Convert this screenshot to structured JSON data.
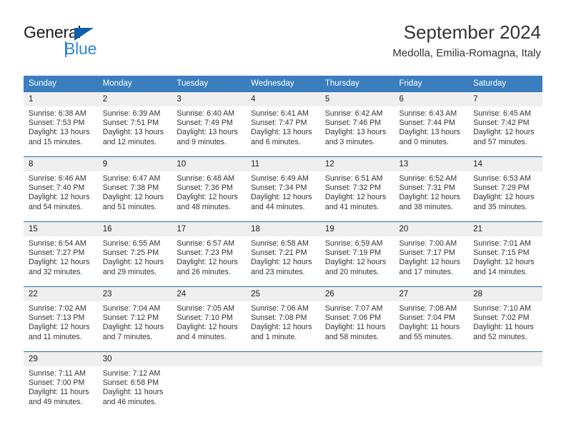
{
  "brand": {
    "name_part1": "General",
    "name_part2": "Blue",
    "triangle_color": "#1060a8",
    "blue_color": "#2f86d4"
  },
  "header": {
    "title": "September 2024",
    "subtitle": "Medolla, Emilia-Romagna, Italy"
  },
  "theme": {
    "header_bg": "#3a7ebf",
    "row_rule": "#2f6fa8",
    "daynum_bg": "#efefef"
  },
  "weekdays": [
    "Sunday",
    "Monday",
    "Tuesday",
    "Wednesday",
    "Thursday",
    "Friday",
    "Saturday"
  ],
  "weeks": [
    [
      {
        "day": "1",
        "sunrise": "Sunrise: 6:38 AM",
        "sunset": "Sunset: 7:53 PM",
        "daylight1": "Daylight: 13 hours",
        "daylight2": "and 15 minutes."
      },
      {
        "day": "2",
        "sunrise": "Sunrise: 6:39 AM",
        "sunset": "Sunset: 7:51 PM",
        "daylight1": "Daylight: 13 hours",
        "daylight2": "and 12 minutes."
      },
      {
        "day": "3",
        "sunrise": "Sunrise: 6:40 AM",
        "sunset": "Sunset: 7:49 PM",
        "daylight1": "Daylight: 13 hours",
        "daylight2": "and 9 minutes."
      },
      {
        "day": "4",
        "sunrise": "Sunrise: 6:41 AM",
        "sunset": "Sunset: 7:47 PM",
        "daylight1": "Daylight: 13 hours",
        "daylight2": "and 6 minutes."
      },
      {
        "day": "5",
        "sunrise": "Sunrise: 6:42 AM",
        "sunset": "Sunset: 7:46 PM",
        "daylight1": "Daylight: 13 hours",
        "daylight2": "and 3 minutes."
      },
      {
        "day": "6",
        "sunrise": "Sunrise: 6:43 AM",
        "sunset": "Sunset: 7:44 PM",
        "daylight1": "Daylight: 13 hours",
        "daylight2": "and 0 minutes."
      },
      {
        "day": "7",
        "sunrise": "Sunrise: 6:45 AM",
        "sunset": "Sunset: 7:42 PM",
        "daylight1": "Daylight: 12 hours",
        "daylight2": "and 57 minutes."
      }
    ],
    [
      {
        "day": "8",
        "sunrise": "Sunrise: 6:46 AM",
        "sunset": "Sunset: 7:40 PM",
        "daylight1": "Daylight: 12 hours",
        "daylight2": "and 54 minutes."
      },
      {
        "day": "9",
        "sunrise": "Sunrise: 6:47 AM",
        "sunset": "Sunset: 7:38 PM",
        "daylight1": "Daylight: 12 hours",
        "daylight2": "and 51 minutes."
      },
      {
        "day": "10",
        "sunrise": "Sunrise: 6:48 AM",
        "sunset": "Sunset: 7:36 PM",
        "daylight1": "Daylight: 12 hours",
        "daylight2": "and 48 minutes."
      },
      {
        "day": "11",
        "sunrise": "Sunrise: 6:49 AM",
        "sunset": "Sunset: 7:34 PM",
        "daylight1": "Daylight: 12 hours",
        "daylight2": "and 44 minutes."
      },
      {
        "day": "12",
        "sunrise": "Sunrise: 6:51 AM",
        "sunset": "Sunset: 7:32 PM",
        "daylight1": "Daylight: 12 hours",
        "daylight2": "and 41 minutes."
      },
      {
        "day": "13",
        "sunrise": "Sunrise: 6:52 AM",
        "sunset": "Sunset: 7:31 PM",
        "daylight1": "Daylight: 12 hours",
        "daylight2": "and 38 minutes."
      },
      {
        "day": "14",
        "sunrise": "Sunrise: 6:53 AM",
        "sunset": "Sunset: 7:29 PM",
        "daylight1": "Daylight: 12 hours",
        "daylight2": "and 35 minutes."
      }
    ],
    [
      {
        "day": "15",
        "sunrise": "Sunrise: 6:54 AM",
        "sunset": "Sunset: 7:27 PM",
        "daylight1": "Daylight: 12 hours",
        "daylight2": "and 32 minutes."
      },
      {
        "day": "16",
        "sunrise": "Sunrise: 6:55 AM",
        "sunset": "Sunset: 7:25 PM",
        "daylight1": "Daylight: 12 hours",
        "daylight2": "and 29 minutes."
      },
      {
        "day": "17",
        "sunrise": "Sunrise: 6:57 AM",
        "sunset": "Sunset: 7:23 PM",
        "daylight1": "Daylight: 12 hours",
        "daylight2": "and 26 minutes."
      },
      {
        "day": "18",
        "sunrise": "Sunrise: 6:58 AM",
        "sunset": "Sunset: 7:21 PM",
        "daylight1": "Daylight: 12 hours",
        "daylight2": "and 23 minutes."
      },
      {
        "day": "19",
        "sunrise": "Sunrise: 6:59 AM",
        "sunset": "Sunset: 7:19 PM",
        "daylight1": "Daylight: 12 hours",
        "daylight2": "and 20 minutes."
      },
      {
        "day": "20",
        "sunrise": "Sunrise: 7:00 AM",
        "sunset": "Sunset: 7:17 PM",
        "daylight1": "Daylight: 12 hours",
        "daylight2": "and 17 minutes."
      },
      {
        "day": "21",
        "sunrise": "Sunrise: 7:01 AM",
        "sunset": "Sunset: 7:15 PM",
        "daylight1": "Daylight: 12 hours",
        "daylight2": "and 14 minutes."
      }
    ],
    [
      {
        "day": "22",
        "sunrise": "Sunrise: 7:02 AM",
        "sunset": "Sunset: 7:13 PM",
        "daylight1": "Daylight: 12 hours",
        "daylight2": "and 11 minutes."
      },
      {
        "day": "23",
        "sunrise": "Sunrise: 7:04 AM",
        "sunset": "Sunset: 7:12 PM",
        "daylight1": "Daylight: 12 hours",
        "daylight2": "and 7 minutes."
      },
      {
        "day": "24",
        "sunrise": "Sunrise: 7:05 AM",
        "sunset": "Sunset: 7:10 PM",
        "daylight1": "Daylight: 12 hours",
        "daylight2": "and 4 minutes."
      },
      {
        "day": "25",
        "sunrise": "Sunrise: 7:06 AM",
        "sunset": "Sunset: 7:08 PM",
        "daylight1": "Daylight: 12 hours",
        "daylight2": "and 1 minute."
      },
      {
        "day": "26",
        "sunrise": "Sunrise: 7:07 AM",
        "sunset": "Sunset: 7:06 PM",
        "daylight1": "Daylight: 11 hours",
        "daylight2": "and 58 minutes."
      },
      {
        "day": "27",
        "sunrise": "Sunrise: 7:08 AM",
        "sunset": "Sunset: 7:04 PM",
        "daylight1": "Daylight: 11 hours",
        "daylight2": "and 55 minutes."
      },
      {
        "day": "28",
        "sunrise": "Sunrise: 7:10 AM",
        "sunset": "Sunset: 7:02 PM",
        "daylight1": "Daylight: 11 hours",
        "daylight2": "and 52 minutes."
      }
    ],
    [
      {
        "day": "29",
        "sunrise": "Sunrise: 7:11 AM",
        "sunset": "Sunset: 7:00 PM",
        "daylight1": "Daylight: 11 hours",
        "daylight2": "and 49 minutes."
      },
      {
        "day": "30",
        "sunrise": "Sunrise: 7:12 AM",
        "sunset": "Sunset: 6:58 PM",
        "daylight1": "Daylight: 11 hours",
        "daylight2": "and 46 minutes."
      },
      {
        "day": "",
        "sunrise": "",
        "sunset": "",
        "daylight1": "",
        "daylight2": ""
      },
      {
        "day": "",
        "sunrise": "",
        "sunset": "",
        "daylight1": "",
        "daylight2": ""
      },
      {
        "day": "",
        "sunrise": "",
        "sunset": "",
        "daylight1": "",
        "daylight2": ""
      },
      {
        "day": "",
        "sunrise": "",
        "sunset": "",
        "daylight1": "",
        "daylight2": ""
      },
      {
        "day": "",
        "sunrise": "",
        "sunset": "",
        "daylight1": "",
        "daylight2": ""
      }
    ]
  ]
}
